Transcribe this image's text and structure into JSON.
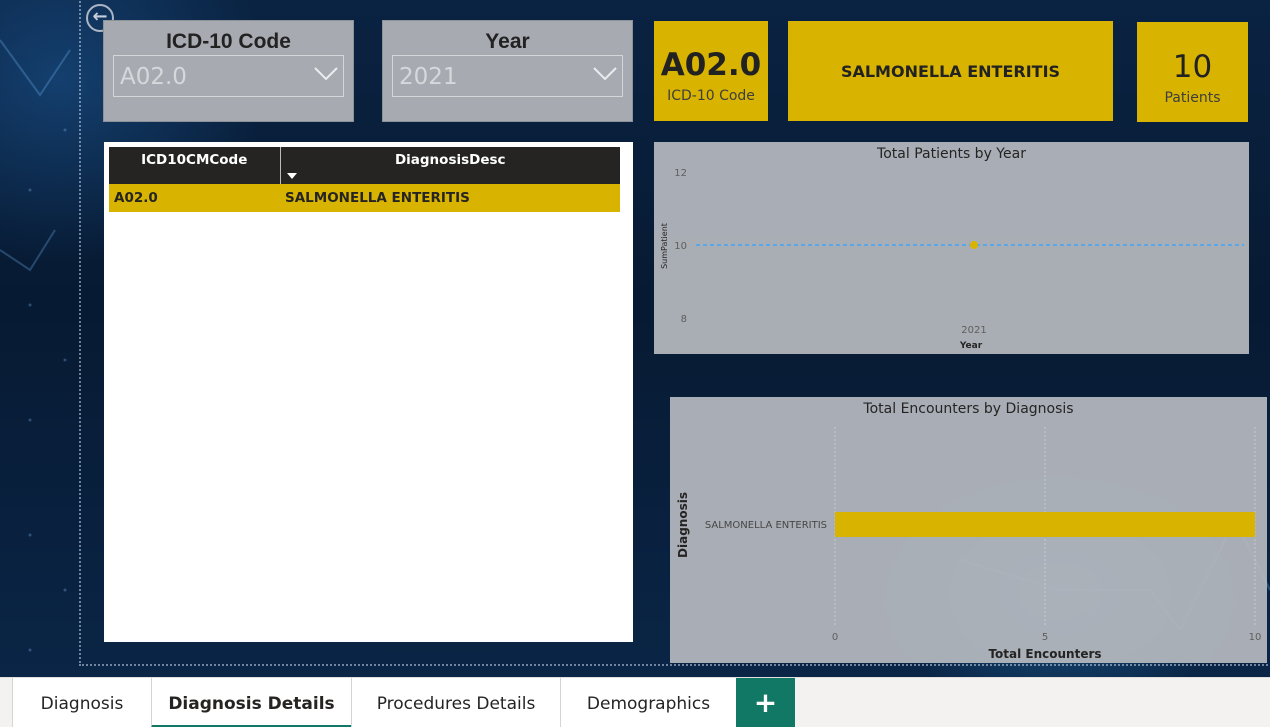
{
  "slicers": {
    "icd": {
      "title": "ICD-10 Code",
      "value": "A02.0"
    },
    "year": {
      "title": "Year",
      "value": "2021"
    }
  },
  "cards": {
    "code": {
      "value": "A02.0",
      "label": "ICD-10 Code"
    },
    "diagnosis": {
      "value": "SALMONELLA ENTERITIS"
    },
    "patients": {
      "value": "10",
      "label": "Patients"
    }
  },
  "table": {
    "columns": [
      "ICD10CMCode",
      "DiagnosisDesc"
    ],
    "rows": [
      {
        "code": "A02.0",
        "desc": "SALMONELLA ENTERITIS"
      }
    ]
  },
  "chart_data": [
    {
      "type": "line",
      "title": "Total Patients by Year",
      "xlabel": "Year",
      "ylabel": "SumPatient",
      "x": [
        "2021"
      ],
      "y_ticks": [
        "12",
        "10",
        "8"
      ],
      "ylim": [
        8,
        12
      ],
      "values": [
        10
      ],
      "reference_line": 10,
      "color": "#d8b400",
      "reference_color": "#5aa6e6"
    },
    {
      "type": "bar",
      "orientation": "horizontal",
      "title": "Total Encounters by Diagnosis",
      "xlabel": "Total Encounters",
      "ylabel": "Diagnosis",
      "categories": [
        "SALMONELLA ENTERITIS"
      ],
      "values": [
        10
      ],
      "x_ticks": [
        "0",
        "5",
        "10"
      ],
      "xlim": [
        0,
        10
      ],
      "color": "#d8b400"
    }
  ],
  "tabs": [
    {
      "label": "Diagnosis",
      "active": false
    },
    {
      "label": "Diagnosis Details",
      "active": true
    },
    {
      "label": "Procedures Details",
      "active": false
    },
    {
      "label": "Demographics",
      "active": false
    }
  ],
  "add_page": {
    "label": "+"
  }
}
